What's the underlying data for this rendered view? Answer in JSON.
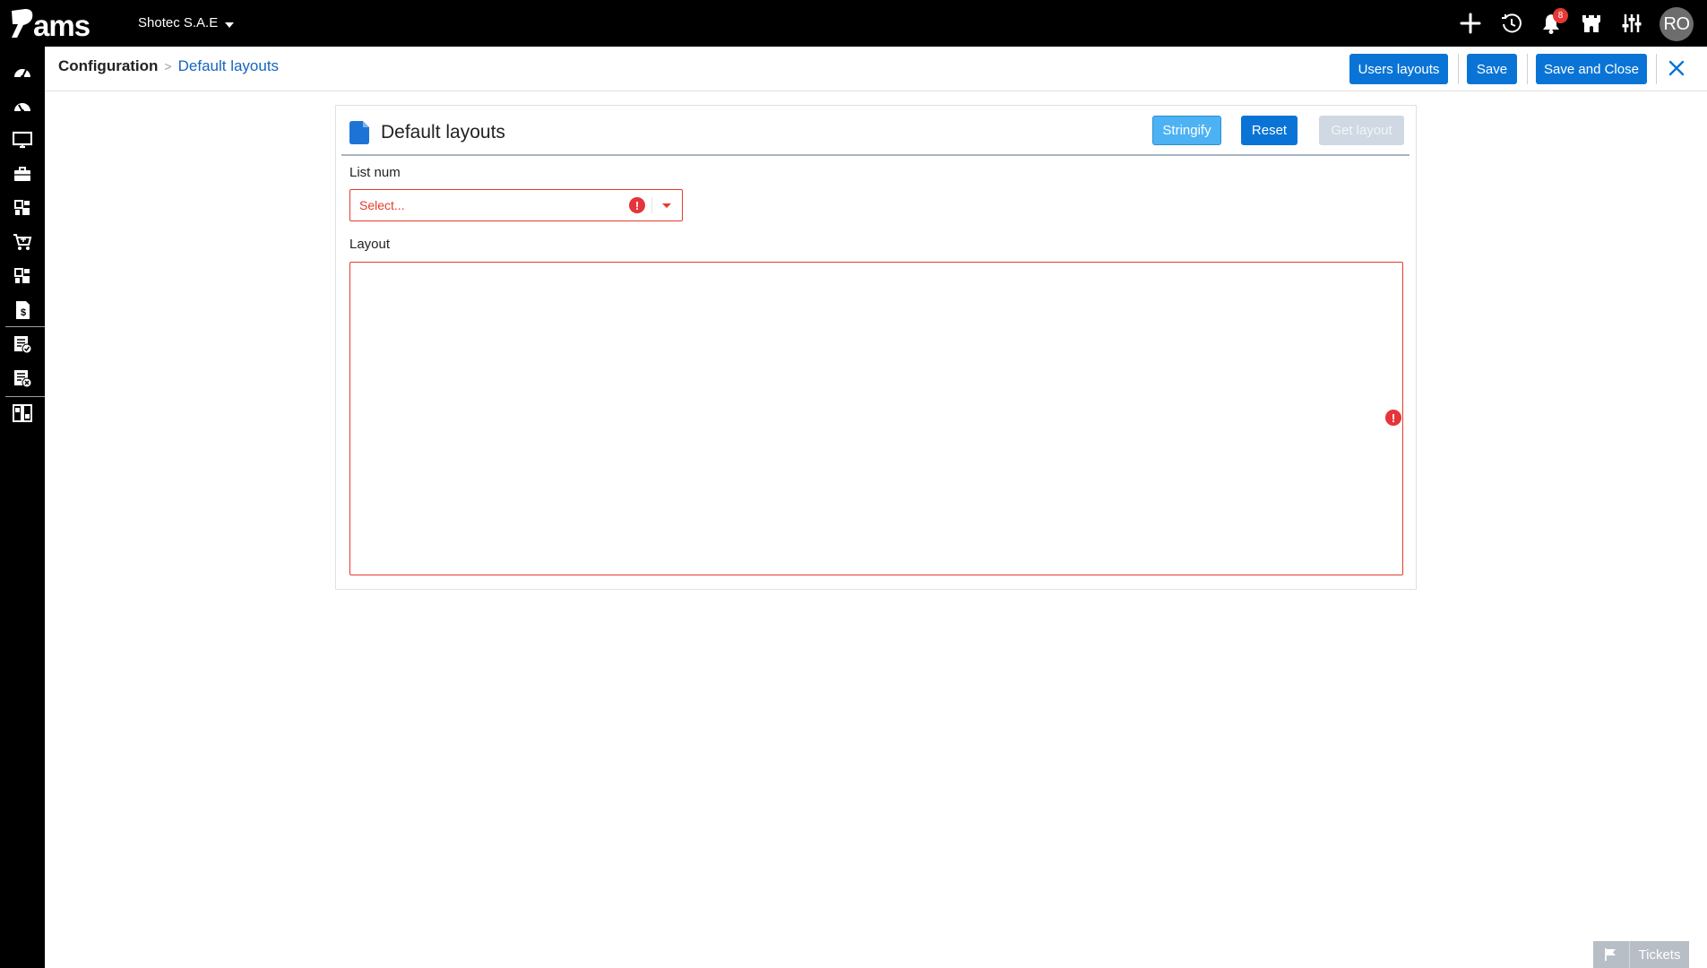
{
  "app": {
    "logo_text": "Rams",
    "company": "Shotec S.A.E",
    "notifications_count": "8",
    "user_initials": "RO"
  },
  "topbar_icons": [
    "plus-icon",
    "history-icon",
    "bell-icon",
    "castle-icon",
    "sliders-icon"
  ],
  "sidebar": {
    "items": [
      "dashboard-icon",
      "dashboard-alt-icon",
      "monitor-icon",
      "briefcase-icon",
      "modules-icon",
      "cart-icon",
      "modules-alt-icon",
      "invoice-icon",
      "checklist-icon",
      "checklist-settings-icon",
      "layout-icon"
    ]
  },
  "breadcrumb": {
    "root": "Configuration",
    "separator": ">",
    "current": "Default layouts"
  },
  "header_actions": {
    "users_layouts": "Users layouts",
    "save": "Save",
    "save_and_close": "Save and Close"
  },
  "card": {
    "title": "Default layouts",
    "stringify": "Stringify",
    "reset": "Reset",
    "get_layout": "Get layout"
  },
  "form": {
    "list_num_label": "List num",
    "list_num_placeholder": "Select...",
    "layout_label": "Layout",
    "layout_value": ""
  },
  "tickets": {
    "label": "Tickets"
  },
  "colors": {
    "primary": "#0a74d6",
    "light_button": "#4db2f4",
    "error": "#e53b2c",
    "topbar": "#000000",
    "link": "#1565c0"
  }
}
